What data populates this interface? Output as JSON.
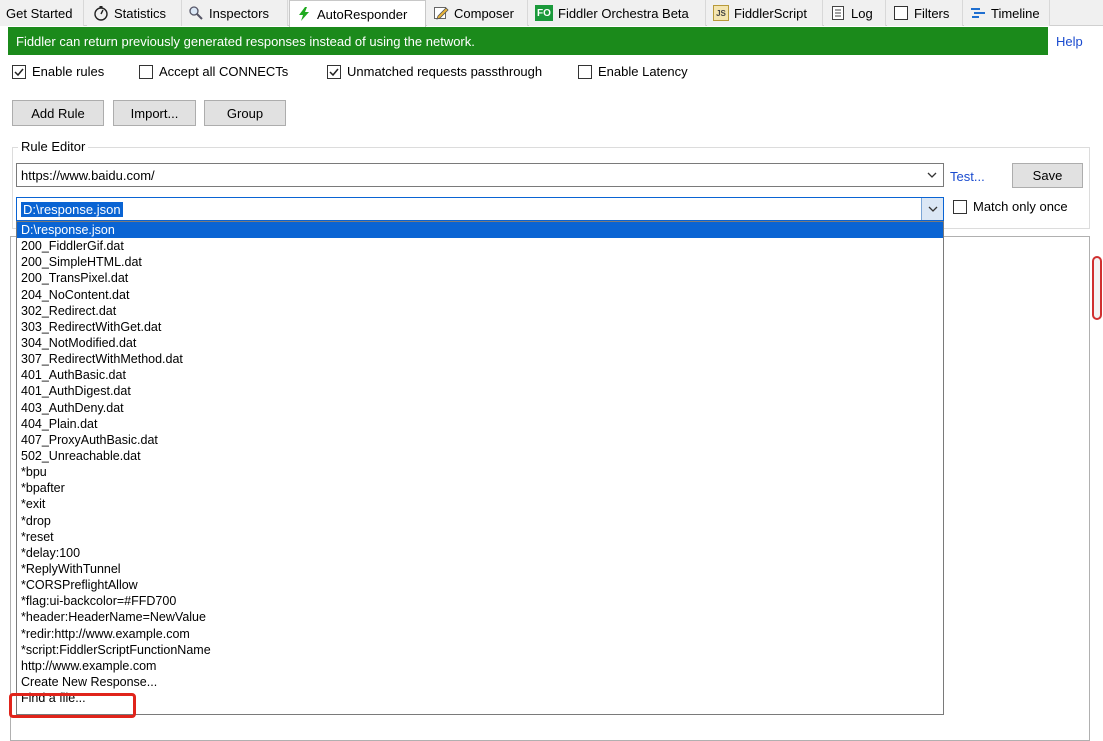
{
  "tabs": [
    {
      "label": "Get Started",
      "icon": "none"
    },
    {
      "label": "Statistics",
      "icon": "stopwatch-icon"
    },
    {
      "label": "Inspectors",
      "icon": "magnifier-icon"
    },
    {
      "label": "AutoResponder",
      "icon": "lightning-icon",
      "active": true
    },
    {
      "label": "Composer",
      "icon": "pencil-icon"
    },
    {
      "label": "Fiddler Orchestra Beta",
      "icon": "fo-icon",
      "icon_text": "FO"
    },
    {
      "label": "FiddlerScript",
      "icon": "script-icon",
      "icon_text": "JS"
    },
    {
      "label": "Log",
      "icon": "log-icon"
    },
    {
      "label": "Filters",
      "icon": "checkbox-icon"
    },
    {
      "label": "Timeline",
      "icon": "timeline-icon"
    }
  ],
  "banner": {
    "text": "Fiddler can return previously generated responses instead of using the network.",
    "help": "Help",
    "color": "#1b8a1b"
  },
  "options": {
    "enable_rules": {
      "label": "Enable rules",
      "checked": true
    },
    "accept_connects": {
      "label": "Accept all CONNECTs",
      "checked": false
    },
    "unmatched_passthrough": {
      "label": "Unmatched requests passthrough",
      "checked": true
    },
    "enable_latency": {
      "label": "Enable Latency",
      "checked": false
    }
  },
  "buttons": {
    "add_rule": "Add Rule",
    "import": "Import...",
    "group": "Group"
  },
  "rule_editor": {
    "legend": "Rule Editor",
    "match_value": "https://www.baidu.com/",
    "test_link": "Test...",
    "save": "Save",
    "action_value": "D:\\response.json",
    "match_once": {
      "label": "Match only once",
      "checked": false
    }
  },
  "dropdown_options": [
    "D:\\response.json",
    "200_FiddlerGif.dat",
    "200_SimpleHTML.dat",
    "200_TransPixel.dat",
    "204_NoContent.dat",
    "302_Redirect.dat",
    "303_RedirectWithGet.dat",
    "304_NotModified.dat",
    "307_RedirectWithMethod.dat",
    "401_AuthBasic.dat",
    "401_AuthDigest.dat",
    "403_AuthDeny.dat",
    "404_Plain.dat",
    "407_ProxyAuthBasic.dat",
    "502_Unreachable.dat",
    "*bpu",
    "*bpafter",
    "*exit",
    "*drop",
    "*reset",
    "*delay:100",
    "*ReplyWithTunnel",
    "*CORSPreflightAllow",
    "*flag:ui-backcolor=#FFD700",
    "*header:HeaderName=NewValue",
    "*redir:http://www.example.com",
    "*script:FiddlerScriptFunctionName",
    "http://www.example.com",
    "Create New Response...",
    "Find a file..."
  ],
  "selected_index": 0,
  "highlight_color": "#e0241b"
}
